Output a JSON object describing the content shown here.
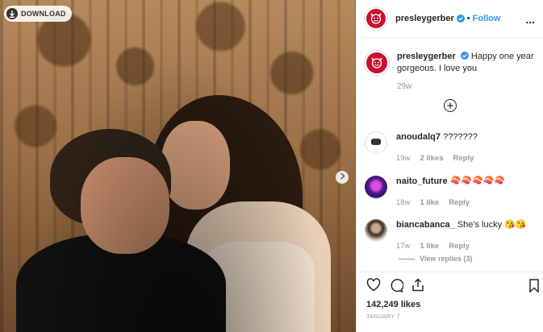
{
  "photo": {
    "download_label": "DOWNLOAD"
  },
  "post": {
    "username": "presleygerber",
    "follow_label": "Follow",
    "more_label": "...",
    "caption_text": "Happy one year gorgeous. I love you",
    "caption_time": "29w"
  },
  "comments": [
    {
      "username": "anoudalq7",
      "text": "???????",
      "time": "19w",
      "likes": "2 likes",
      "reply": "Reply"
    },
    {
      "username": "naito_future",
      "text": "🍣🍣🍣🍣🍣",
      "time": "18w",
      "likes": "1 like",
      "reply": "Reply"
    },
    {
      "username": "biancabanca_",
      "text": "She's lucky 😘😘",
      "time": "17w",
      "likes": "1 like",
      "reply": "Reply"
    }
  ],
  "view_replies": "View replies (3)",
  "engagement": {
    "likes": "142,249 likes",
    "date": "JANUARY 7"
  },
  "icons": {
    "avatar": "devil-face-icon",
    "verified": "verified-badge-icon",
    "load_more": "plus-circle-icon",
    "like": "heart-icon",
    "comment": "comment-bubble-icon",
    "share": "share-icon",
    "save": "bookmark-icon"
  },
  "colors": {
    "accent": "#3897f0",
    "avatar": "#c8102e",
    "muted": "#999999",
    "text": "#262626"
  }
}
